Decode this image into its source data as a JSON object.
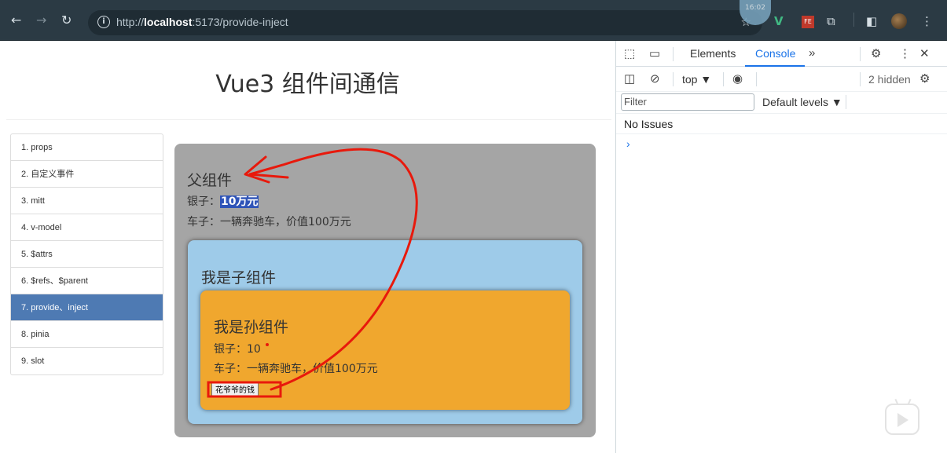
{
  "browser": {
    "url_prefix": "http://",
    "url_host": "localhost",
    "url_rest": ":5173/provide-inject",
    "clock": "16:02"
  },
  "page": {
    "title": "Vue3 组件间通信",
    "nav": [
      {
        "label": "1. props"
      },
      {
        "label": "2. 自定义事件"
      },
      {
        "label": "3. mitt"
      },
      {
        "label": "4. v-model"
      },
      {
        "label": "5. $attrs"
      },
      {
        "label": "6. $refs、$parent"
      },
      {
        "label": "7. provide、inject"
      },
      {
        "label": "8. pinia"
      },
      {
        "label": "9. slot"
      }
    ],
    "father": {
      "title": "父组件",
      "money_label": "银子：",
      "money_value": "10万元",
      "car_line": "车子：一辆奔驰车，价值100万元"
    },
    "child": {
      "title": "我是子组件"
    },
    "grandchild": {
      "title": "我是孙组件",
      "money_line": "银子：10",
      "car_line": "车子：一辆奔驰车，价值100万元",
      "button_label": "花爷爷的钱"
    }
  },
  "devtools": {
    "tabs": [
      "Elements",
      "Console"
    ],
    "active_tab": "Console",
    "context": "top",
    "hidden_count": "2 hidden",
    "filter_placeholder": "Filter",
    "levels": "Default levels",
    "no_issues": "No Issues",
    "prompt": "›"
  },
  "colors": {
    "accent_nav": "#4e7ab3",
    "father_bg": "#a5a5a5",
    "child_bg": "#9ecbe9",
    "grandchild_bg": "#f0a72e",
    "annotation_red": "#e8190c"
  }
}
